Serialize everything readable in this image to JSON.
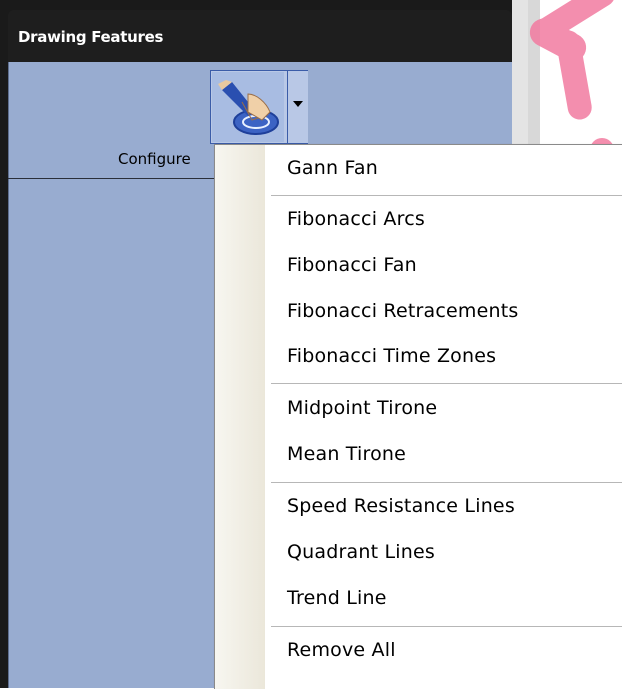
{
  "panel": {
    "title": "Drawing Features",
    "configure_label": "Configure"
  },
  "tool_button": {
    "icon": "drawing-hand-pen-icon",
    "dropdown_icon": "dropdown-arrow-icon"
  },
  "logo_icon": "pink-cross-logo-icon",
  "menu": {
    "items": [
      {
        "label": "Gann Fan"
      },
      {
        "label": "Fibonacci Arcs"
      },
      {
        "label": "Fibonacci Fan"
      },
      {
        "label": "Fibonacci Retracements"
      },
      {
        "label": "Fibonacci Time Zones"
      },
      {
        "label": "Midpoint Tirone"
      },
      {
        "label": "Mean Tirone"
      },
      {
        "label": "Speed Resistance Lines"
      },
      {
        "label": "Quadrant Lines"
      },
      {
        "label": "Trend Line"
      },
      {
        "label": "Remove All"
      }
    ]
  },
  "colors": {
    "panel_body": "#98acd0",
    "header": "#1e1e1e",
    "logo_pink": "#f0608a"
  }
}
